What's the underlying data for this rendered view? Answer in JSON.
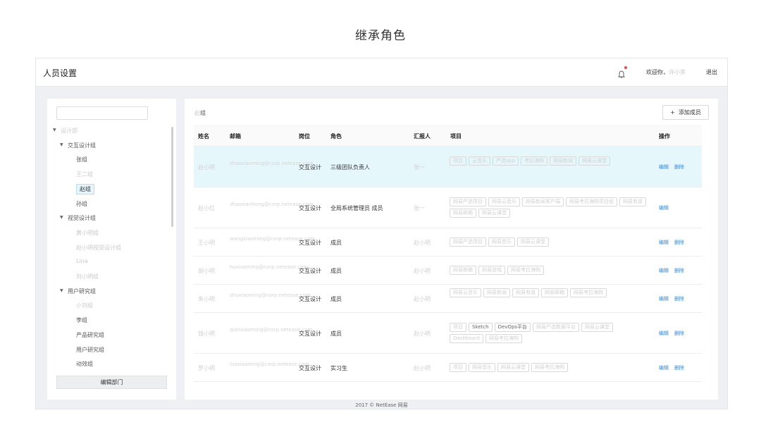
{
  "caption": "继承角色",
  "header": {
    "title": "人员设置",
    "welcome_prefix": "欢迎你，",
    "username": "许小茶",
    "logout": "退出"
  },
  "sidebar": {
    "search_placeholder": "",
    "edit_button": "编辑部门",
    "tree": [
      {
        "label": "设计部",
        "level": 0,
        "blur": true,
        "expanded": true
      },
      {
        "label": "交互设计组",
        "level": 1,
        "blur": false,
        "expanded": true
      },
      {
        "label": "张组",
        "level": 2,
        "blur": false
      },
      {
        "label": "王二组",
        "level": 2,
        "blur": true
      },
      {
        "label": "赵组",
        "level": 2,
        "blur": false,
        "selected": true
      },
      {
        "label": "孙组",
        "level": 2,
        "blur": false
      },
      {
        "label": "视觉设计组",
        "level": 1,
        "blur": false,
        "expanded": true
      },
      {
        "label": "黄小明组",
        "level": 2,
        "blur": true
      },
      {
        "label": "赵小明视觉设计组",
        "level": 2,
        "blur": true
      },
      {
        "label": "Lina",
        "level": 2,
        "blur": true
      },
      {
        "label": "刘小明组",
        "level": 2,
        "blur": true
      },
      {
        "label": "用户研究组",
        "level": 1,
        "blur": false,
        "expanded": true
      },
      {
        "label": "小刘组",
        "level": 2,
        "blur": true
      },
      {
        "label": "李组",
        "level": 2,
        "blur": false
      },
      {
        "label": "产品研究组",
        "level": 2,
        "blur": false
      },
      {
        "label": "用户研究组",
        "level": 2,
        "blur": false
      },
      {
        "label": "动效组",
        "level": 2,
        "blur": false
      }
    ]
  },
  "main": {
    "group_title_blur": "赵",
    "group_title_suffix": "组",
    "add_button": "添加成员",
    "add_icon": "+",
    "columns": [
      "姓名",
      "邮箱",
      "岗位",
      "角色",
      "汇报人",
      "项目",
      "操作"
    ],
    "rows": [
      {
        "name": "赵小明",
        "email": "zhaoxiaoming@corp.netease.com",
        "post": "交互设计",
        "role": "三级团队负责人",
        "reporter": "张一",
        "tags": [
          "项目",
          "云音乐",
          "严选app",
          "考拉海购",
          "网易新闻",
          "网易云课堂"
        ],
        "ops": [
          "编辑",
          "删除"
        ],
        "highlight": true
      },
      {
        "name": "赵小红",
        "email": "zhaoxiaohong@corp.netease.com",
        "post": "交互设计",
        "role": "全局系统管理员 成员",
        "reporter": "张一",
        "tags": [
          "网易严选项目",
          "网易云音乐",
          "网易新闻客户端",
          "网易考拉海购项目组",
          "网易有道",
          "网易邮箱",
          "网易云课堂"
        ],
        "ops": [
          "编辑"
        ]
      },
      {
        "name": "王小明",
        "email": "wangxiaoming@corp.netease.com",
        "post": "交互设计",
        "role": "成员",
        "reporter": "赵小明",
        "tags": [
          "网易严选项目",
          "网易音乐",
          "网易云课堂"
        ],
        "ops": [
          "编辑",
          "删除"
        ]
      },
      {
        "name": "胡小明",
        "email": "huxiaoming@corp.netease.com",
        "post": "交互设计",
        "role": "成员",
        "reporter": "赵小明",
        "tags": [
          "网易邮箱",
          "网易游戏",
          "网易考拉海购"
        ],
        "ops": [
          "编辑",
          "删除"
        ]
      },
      {
        "name": "朱小明",
        "email": "zhuxiaoming@corp.netease.com",
        "post": "交互设计",
        "role": "成员",
        "reporter": "赵小明",
        "tags": [
          "网易云音乐",
          "网易新闻",
          "网易有道",
          "网易邮箱",
          "网易考拉海购"
        ],
        "ops": [
          "编辑",
          "删除"
        ]
      },
      {
        "name": "钱小明",
        "email": "qianxiaoming@corp.netease.com",
        "post": "交互设计",
        "role": "成员",
        "reporter": "赵小明",
        "tags": [
          "项目",
          "Sketch",
          "DevOps平台",
          "网易严选数据平台",
          "网易云课堂",
          "Dashboard",
          "网易考拉海购"
        ],
        "dark_tags": [
          1,
          2
        ],
        "ops": [
          "编辑",
          "删除"
        ]
      },
      {
        "name": "罗小明",
        "email": "luoxiaoming@corp.netease.com",
        "post": "交互设计",
        "role": "实习生",
        "reporter": "赵小明",
        "tags": [
          "项目",
          "网易音乐",
          "网易云课堂",
          "网易考拉海购"
        ],
        "ops": [
          "编辑",
          "删除"
        ]
      }
    ]
  },
  "footer": "2017 © NetEase 网易",
  "colors": {
    "link": "#2b8ae0",
    "highlight_row": "#e6f7fc",
    "notify_dot": "#e84a4a"
  }
}
